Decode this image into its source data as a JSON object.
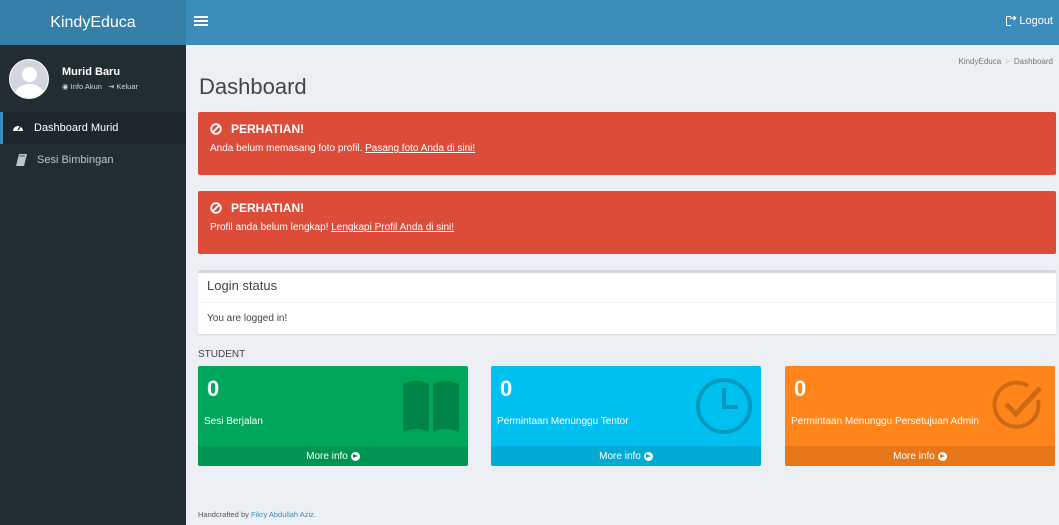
{
  "header": {
    "logo": "KindyEduca",
    "logout_label": "Logout"
  },
  "sidebar": {
    "user_name": "Murid Baru",
    "info_link": "Info Akun",
    "logout_link": "Keluar",
    "items": [
      {
        "label": "Dashboard Murid",
        "icon": "dashboard-icon",
        "active": true
      },
      {
        "label": "Sesi Bimbingan",
        "icon": "book-icon",
        "active": false
      }
    ]
  },
  "page": {
    "title": "Dashboard",
    "breadcrumb": [
      "KindyEduca",
      "Dashboard"
    ]
  },
  "alerts": [
    {
      "title": "PERHATIAN!",
      "text": "Anda belum memasang foto profil.",
      "link": "Pasang foto Anda di sini!"
    },
    {
      "title": "PERHATIAN!",
      "text": "Profil anda belum lengkap!",
      "link": "Lengkapi Profil Anda di sini!"
    }
  ],
  "login_box": {
    "title": "Login status",
    "body": "You are logged in!"
  },
  "section_label": "STUDENT",
  "stats": [
    {
      "value": "0",
      "label": "Sesi Berjalan",
      "more": "More info",
      "icon": "book-icon",
      "color": "#00a65a"
    },
    {
      "value": "0",
      "label": "Permintaan Menunggu Tentor",
      "more": "More info",
      "icon": "clock-icon",
      "color": "#00c0ef"
    },
    {
      "value": "0",
      "label": "Permintaan Menunggu Persetujuan Admin",
      "more": "More info",
      "icon": "check-circle-icon",
      "color": "#ff851b"
    }
  ],
  "footer": {
    "prefix": "Handcrafted by",
    "author": "Fikry Abdullah Aziz."
  },
  "colors": {
    "header": "#3c8dbc",
    "logo_bg": "#367fa9",
    "sidebar": "#222d32",
    "danger": "#dd4b39"
  }
}
